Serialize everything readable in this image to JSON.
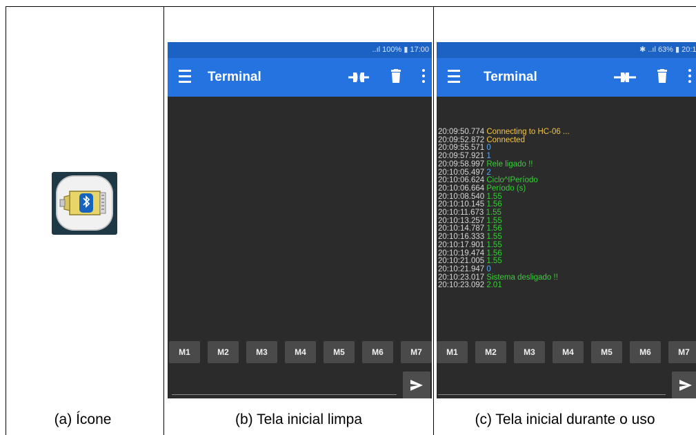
{
  "captions": {
    "a": "(a) Ícone",
    "b": "(b) Tela inicial limpa",
    "c": "(c) Tela inicial durante o uso"
  },
  "phone_b": {
    "status_text": "..ıl 100% ▮ 17:00",
    "app_title": "Terminal",
    "macros": [
      "M1",
      "M2",
      "M3",
      "M4",
      "M5",
      "M6",
      "M7"
    ]
  },
  "phone_c": {
    "status_text": "✱ ..ıl 63% ▮ 20:1",
    "app_title": "Terminal",
    "macros": [
      "M1",
      "M2",
      "M3",
      "M4",
      "M5",
      "M6",
      "M7"
    ],
    "log": [
      {
        "time": "20:09:50.774",
        "msg": "Connecting to HC-06 ...",
        "kind": "status"
      },
      {
        "time": "20:09:52.872",
        "msg": "Connected",
        "kind": "status"
      },
      {
        "time": "20:09:55.571",
        "msg": "0",
        "kind": "sent"
      },
      {
        "time": "20:09:57.921",
        "msg": "1",
        "kind": "sent"
      },
      {
        "time": "20:09:58.997",
        "msg": "Rele ligado !!",
        "kind": "recv"
      },
      {
        "time": "20:10:05.497",
        "msg": "2",
        "kind": "sent"
      },
      {
        "time": "20:10:06.624",
        "msg": "Ciclo^IPeríodo",
        "kind": "recv"
      },
      {
        "time": "20:10:06.664",
        "msg": "Período (s)",
        "kind": "recv"
      },
      {
        "time": "20:10:08.540",
        "msg": "1.55",
        "kind": "recv"
      },
      {
        "time": "20:10:10.145",
        "msg": "1.56",
        "kind": "recv"
      },
      {
        "time": "20:10:11.673",
        "msg": "1.55",
        "kind": "recv"
      },
      {
        "time": "20:10:13.257",
        "msg": "1.55",
        "kind": "recv"
      },
      {
        "time": "20:10:14.787",
        "msg": "1.56",
        "kind": "recv"
      },
      {
        "time": "20:10:16.333",
        "msg": "1.55",
        "kind": "recv"
      },
      {
        "time": "20:10:17.901",
        "msg": "1.55",
        "kind": "recv"
      },
      {
        "time": "20:10:19.474",
        "msg": "1.56",
        "kind": "recv"
      },
      {
        "time": "20:10:21.005",
        "msg": "1.55",
        "kind": "recv"
      },
      {
        "time": "20:10:21.947",
        "msg": "0",
        "kind": "sent"
      },
      {
        "time": "20:10:23.017",
        "msg": "Sistema desligado !!",
        "kind": "recv"
      },
      {
        "time": "20:10:23.092",
        "msg": "2.01",
        "kind": "recv"
      }
    ]
  },
  "colors": {
    "appbar": "#2473e0",
    "statusbar": "#1b62c4",
    "screen": "#2b2b2b",
    "status_msg": "#f5c542",
    "sent_msg": "#5aa8f0",
    "recv_msg": "#35d135"
  },
  "icons": {
    "app": "bluetooth-serial-connector-icon",
    "menu": "hamburger-menu-icon",
    "connect": "plug-connect-icon",
    "trash": "trash-icon",
    "more": "kebab-menu-icon",
    "send": "send-icon"
  }
}
